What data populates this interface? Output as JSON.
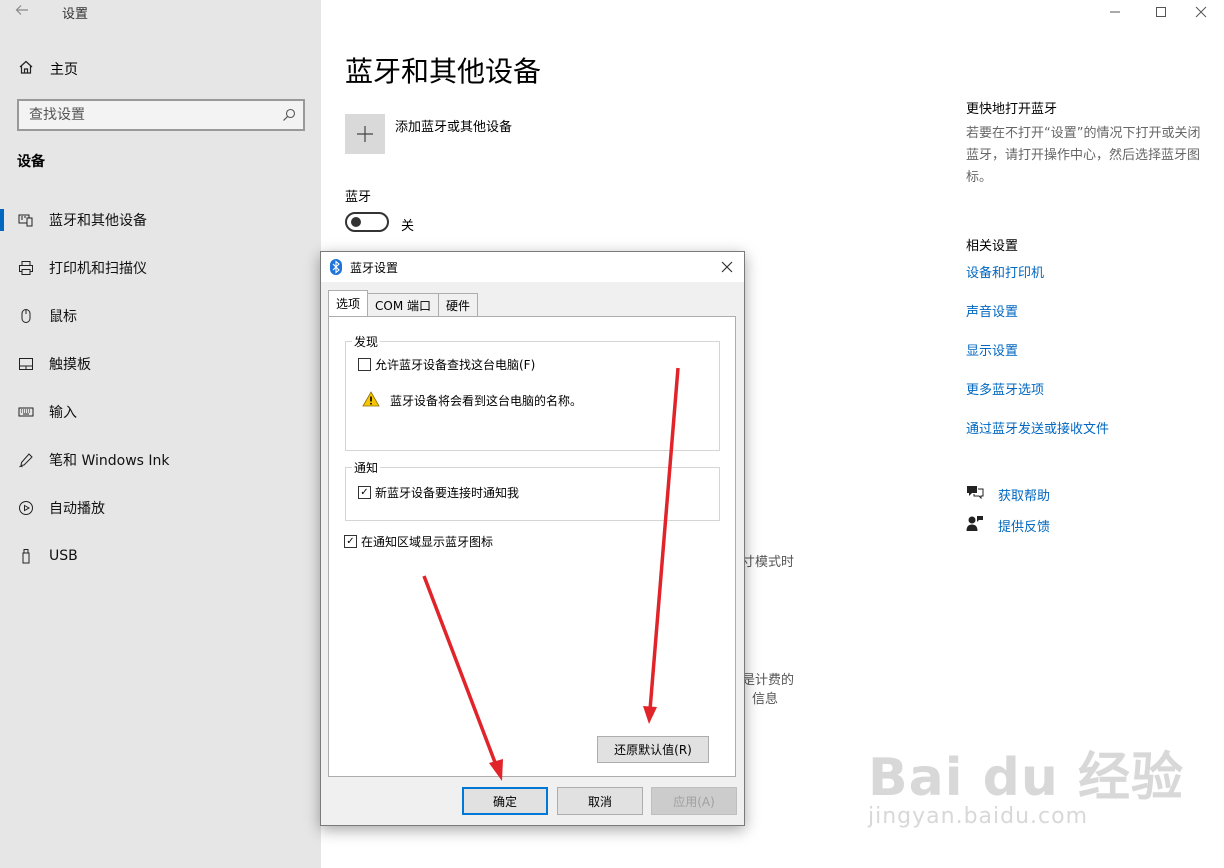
{
  "window": {
    "app_title": "设置",
    "controls": [
      "minimize",
      "maximize",
      "close"
    ]
  },
  "sidebar": {
    "home_label": "主页",
    "search_placeholder": "查找设置",
    "section_title": "设备",
    "items": [
      {
        "label": "蓝牙和其他设备",
        "icon": "bluetooth-devices-icon",
        "active": true
      },
      {
        "label": "打印机和扫描仪",
        "icon": "printer-icon",
        "active": false
      },
      {
        "label": "鼠标",
        "icon": "mouse-icon",
        "active": false
      },
      {
        "label": "触摸板",
        "icon": "touchpad-icon",
        "active": false
      },
      {
        "label": "输入",
        "icon": "keyboard-icon",
        "active": false
      },
      {
        "label": "笔和 Windows Ink",
        "icon": "pen-icon",
        "active": false
      },
      {
        "label": "自动播放",
        "icon": "autoplay-icon",
        "active": false
      },
      {
        "label": "USB",
        "icon": "usb-icon",
        "active": false
      }
    ]
  },
  "main": {
    "page_title": "蓝牙和其他设备",
    "add_device_label": "添加蓝牙或其他设备",
    "bluetooth_label": "蓝牙",
    "toggle_state": "关",
    "toggle_on": false,
    "partial_text_1": "寸模式时",
    "partial_text_2": "是计费的",
    "partial_text_3": "信息"
  },
  "right_pane": {
    "quick_heading": "更快地打开蓝牙",
    "quick_desc": "若要在不打开“设置”的情况下打开或关闭蓝牙，请打开操作中心，然后选择蓝牙图标。",
    "related_heading": "相关设置",
    "links": [
      "设备和打印机",
      "声音设置",
      "显示设置",
      "更多蓝牙选项",
      "通过蓝牙发送或接收文件"
    ],
    "help_label": "获取帮助",
    "feedback_label": "提供反馈"
  },
  "dialog": {
    "title": "蓝牙设置",
    "tabs": [
      "选项",
      "COM 端口",
      "硬件"
    ],
    "active_tab": 0,
    "discovery_group": "发现",
    "discovery_checkbox": "允许蓝牙设备查找这台电脑(F)",
    "discovery_checked": false,
    "warning_text": "蓝牙设备将会看到这台电脑的名称。",
    "notify_group": "通知",
    "notify_checkbox": "新蓝牙设备要连接时通知我",
    "notify_checked": true,
    "tray_checkbox": "在通知区域显示蓝牙图标",
    "tray_checked": true,
    "restore_button": "还原默认值(R)",
    "ok_button": "确定",
    "cancel_button": "取消",
    "apply_button": "应用(A)",
    "apply_disabled": true
  },
  "colors": {
    "accent": "#0067c0",
    "sidebar_bg": "#e6e6e6",
    "annotation_arrow": "#e0242a"
  },
  "watermark": {
    "logo_text": "Bai du 经验",
    "url_text": "jingyan.baidu.com"
  }
}
